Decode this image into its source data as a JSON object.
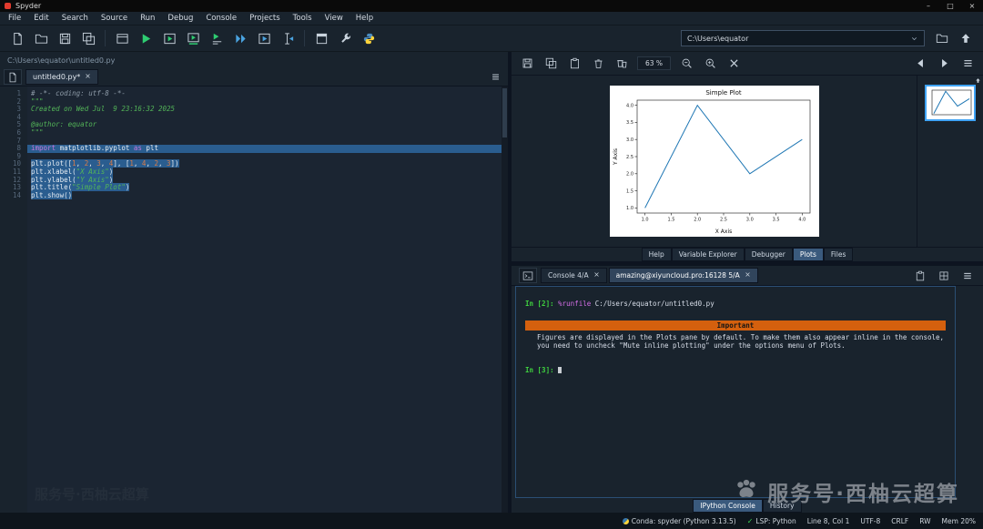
{
  "window": {
    "title": "Spyder"
  },
  "menu": {
    "items": [
      "File",
      "Edit",
      "Search",
      "Source",
      "Run",
      "Debug",
      "Console",
      "Projects",
      "Tools",
      "View",
      "Help"
    ]
  },
  "toolbar": {
    "buttons": [
      {
        "name": "new-file"
      },
      {
        "name": "open-file"
      },
      {
        "name": "save-file"
      },
      {
        "name": "save-all"
      },
      {
        "sep": true
      },
      {
        "name": "new-cell"
      },
      {
        "name": "run-file"
      },
      {
        "name": "run-cell"
      },
      {
        "name": "run-cell-advance"
      },
      {
        "name": "run-selection"
      },
      {
        "name": "debug-file"
      },
      {
        "name": "debug-cell"
      },
      {
        "name": "debug-selection"
      },
      {
        "sep": true
      },
      {
        "name": "maximize-pane"
      },
      {
        "name": "preferences"
      },
      {
        "name": "python-path"
      }
    ],
    "path_value": "C:\\Users\\equator",
    "side_buttons": [
      {
        "name": "browse-folder"
      },
      {
        "name": "go-up"
      }
    ]
  },
  "editor": {
    "breadcrumb": "C:\\Users\\equator\\untitled0.py",
    "tab_label": "untitled0.py*",
    "lines": [
      {
        "n": "1",
        "tokens": [
          {
            "t": "# -*- coding: utf-8 -*-",
            "c": "com"
          }
        ]
      },
      {
        "n": "2",
        "tokens": [
          {
            "t": "\"\"\"",
            "c": "str"
          }
        ]
      },
      {
        "n": "3",
        "tokens": [
          {
            "t": "Created on Wed Jul  9 23:16:32 2025",
            "c": "str"
          }
        ]
      },
      {
        "n": "4",
        "tokens": []
      },
      {
        "n": "5",
        "tokens": [
          {
            "t": "@author: equator",
            "c": "str"
          }
        ]
      },
      {
        "n": "6",
        "tokens": [
          {
            "t": "\"\"\"",
            "c": "str"
          }
        ]
      },
      {
        "n": "7",
        "tokens": []
      },
      {
        "n": "8",
        "sel": true,
        "full": true,
        "tokens": [
          {
            "t": "import",
            "c": "kw"
          },
          {
            "t": " matplotlib.pyplot ",
            "c": "pl"
          },
          {
            "t": "as",
            "c": "kw"
          },
          {
            "t": " plt",
            "c": "pl"
          }
        ]
      },
      {
        "n": "9",
        "tokens": []
      },
      {
        "n": "10",
        "sel": true,
        "tokens": [
          {
            "t": "plt.plot([",
            "c": "pl"
          },
          {
            "t": "1",
            "c": "num"
          },
          {
            "t": ", ",
            "c": "pl"
          },
          {
            "t": "2",
            "c": "num"
          },
          {
            "t": ", ",
            "c": "pl"
          },
          {
            "t": "3",
            "c": "num"
          },
          {
            "t": ", ",
            "c": "pl"
          },
          {
            "t": "4",
            "c": "num"
          },
          {
            "t": "], [",
            "c": "pl"
          },
          {
            "t": "1",
            "c": "num"
          },
          {
            "t": ", ",
            "c": "pl"
          },
          {
            "t": "4",
            "c": "num"
          },
          {
            "t": ", ",
            "c": "pl"
          },
          {
            "t": "2",
            "c": "num"
          },
          {
            "t": ", ",
            "c": "pl"
          },
          {
            "t": "3",
            "c": "num"
          },
          {
            "t": "])",
            "c": "pl"
          }
        ]
      },
      {
        "n": "11",
        "sel": true,
        "tokens": [
          {
            "t": "plt.xlabel(",
            "c": "pl"
          },
          {
            "t": "\"X Axis\"",
            "c": "str"
          },
          {
            "t": ")",
            "c": "pl"
          }
        ]
      },
      {
        "n": "12",
        "sel": true,
        "tokens": [
          {
            "t": "plt.ylabel(",
            "c": "pl"
          },
          {
            "t": "\"Y Axis\"",
            "c": "str"
          },
          {
            "t": ")",
            "c": "pl"
          }
        ]
      },
      {
        "n": "13",
        "sel": true,
        "tokens": [
          {
            "t": "plt.title(",
            "c": "pl"
          },
          {
            "t": "\"Simple Plot\"",
            "c": "str"
          },
          {
            "t": ")",
            "c": "pl"
          }
        ]
      },
      {
        "n": "14",
        "sel": true,
        "tokens": [
          {
            "t": "plt.show()",
            "c": "pl"
          }
        ]
      }
    ]
  },
  "plots": {
    "toolbar_buttons": [
      {
        "name": "save-plot"
      },
      {
        "name": "save-all-plots"
      },
      {
        "name": "copy-plot"
      },
      {
        "name": "remove-plot"
      },
      {
        "name": "remove-all-plots"
      },
      {
        "zoom": true
      },
      {
        "name": "zoom-out"
      },
      {
        "name": "zoom-in"
      },
      {
        "name": "close-plot"
      }
    ],
    "zoom_label": "63 %",
    "nav_buttons": [
      {
        "name": "previous-plot"
      },
      {
        "name": "next-plot"
      },
      {
        "name": "plots-options"
      }
    ]
  },
  "chart_data": {
    "type": "line",
    "title": "Simple Plot",
    "xlabel": "X Axis",
    "ylabel": "Y Axis",
    "x": [
      1,
      2,
      3,
      4
    ],
    "y": [
      1,
      4,
      2,
      3
    ],
    "xticks": [
      1.0,
      1.5,
      2.0,
      2.5,
      3.0,
      3.5,
      4.0
    ],
    "yticks": [
      1.0,
      1.5,
      2.0,
      2.5,
      3.0,
      3.5,
      4.0
    ],
    "xlim": [
      0.85,
      4.15
    ],
    "ylim": [
      0.85,
      4.15
    ],
    "line_color": "#1f77b4",
    "grid": false,
    "legend": null
  },
  "pane_tabs": {
    "items": [
      "Help",
      "Variable Explorer",
      "Debugger",
      "Plots",
      "Files"
    ],
    "active": 3
  },
  "console": {
    "tabs": [
      {
        "label": "Console 4/A",
        "active": false
      },
      {
        "label": "amazing@xiyuncloud.pro:16128 5/A",
        "active": true
      }
    ],
    "corner_buttons": [
      {
        "name": "copy-console"
      },
      {
        "name": "console-env"
      },
      {
        "name": "console-options"
      }
    ],
    "lines": [
      {
        "segments": [
          {
            "t": "In [2]: ",
            "c": "prompt"
          },
          {
            "t": "%runfile",
            "c": "magic"
          },
          {
            "t": " C:/Users/equator/untitled0.py",
            "c": "plain"
          }
        ]
      }
    ],
    "banner": {
      "title": "Important",
      "body": "Figures are displayed in the Plots pane by default. To make them also appear inline in the console, you need to uncheck \"Mute inline plotting\" under the options menu of Plots."
    },
    "prompt_line": {
      "segments": [
        {
          "t": "In [3]: ",
          "c": "prompt"
        }
      ]
    },
    "bottom_tabs": {
      "items": [
        "IPython Console",
        "History"
      ],
      "active": 0
    }
  },
  "statusbar": {
    "items": [
      {
        "icon": "python",
        "text": "Conda: spyder (Python 3.13.5)"
      },
      {
        "icon": "check",
        "text": "LSP: Python"
      },
      {
        "text": "Line 8, Col 1"
      },
      {
        "text": "UTF-8"
      },
      {
        "text": "CRLF"
      },
      {
        "text": "RW"
      },
      {
        "text": "Mem 20%"
      }
    ]
  },
  "watermark": {
    "text": "服务号·西柚云超算"
  }
}
